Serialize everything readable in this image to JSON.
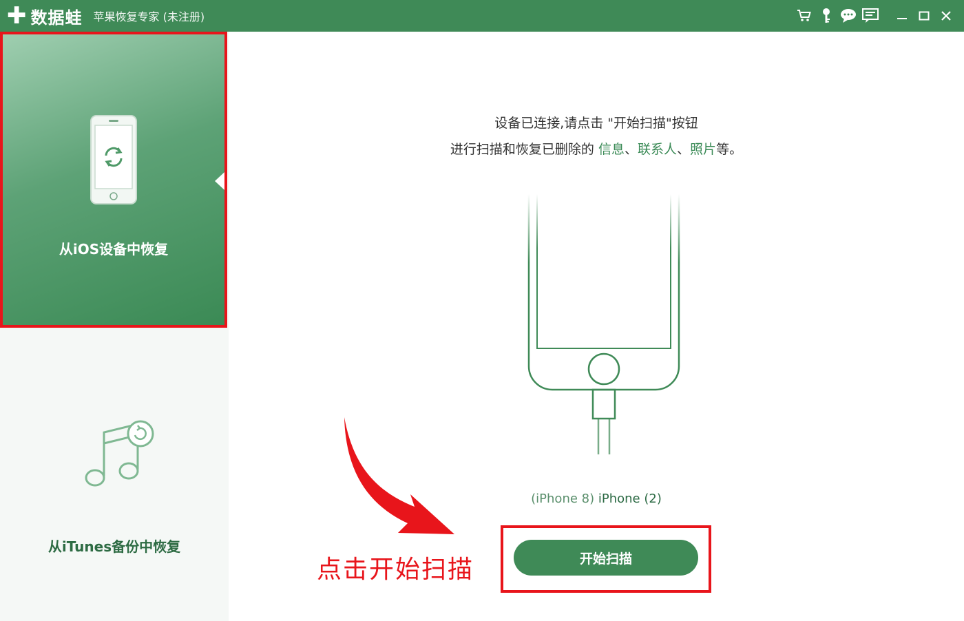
{
  "titlebar": {
    "brand": "数据蛙",
    "app_title": "苹果恢复专家 (未注册)",
    "icons": [
      "cart-icon",
      "key-icon",
      "chat-icon",
      "feedback-icon",
      "minimize-icon",
      "maximize-icon",
      "close-icon"
    ]
  },
  "sidebar": {
    "items": [
      {
        "label": "从iOS设备中恢复",
        "active": true
      },
      {
        "label": "从iTunes备份中恢复",
        "active": false
      }
    ]
  },
  "main": {
    "message_line1": "设备已连接,请点击 \"开始扫描\"按钮",
    "message_line2_prefix": "进行扫描和恢复已删除的",
    "message_highlights": [
      "信息",
      "联系人",
      "照片"
    ],
    "message_sep": "、",
    "message_suffix": "等。",
    "device_model": "(iPhone 8)",
    "device_name": "iPhone (2)",
    "scan_button": "开始扫描",
    "annotation": "点击开始扫描"
  },
  "colors": {
    "brand_green": "#3f8a57",
    "highlight_red": "#e8151b"
  }
}
